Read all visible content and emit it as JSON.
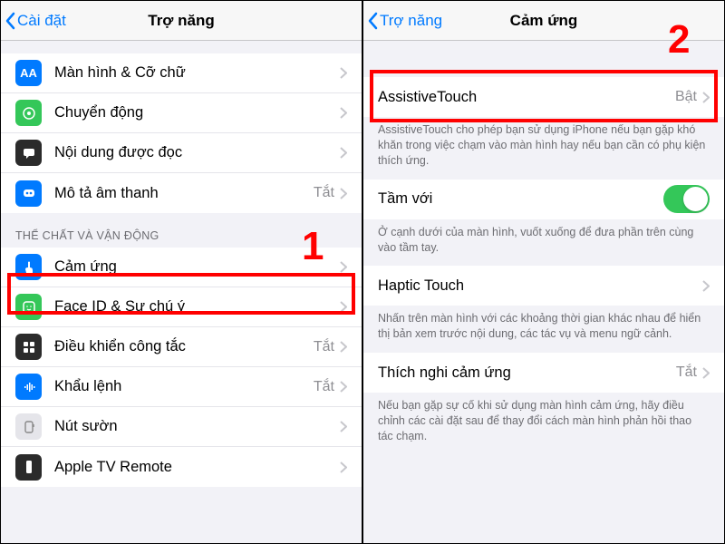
{
  "left": {
    "back": "Cài đặt",
    "title": "Trợ năng",
    "rows1": [
      {
        "icon": "AA",
        "color": "#007aff",
        "label": "Màn hình & Cỡ chữ",
        "value": ""
      },
      {
        "icon": "motion",
        "color": "#34c759",
        "label": "Chuyển động",
        "value": ""
      },
      {
        "icon": "speak",
        "color": "#2b2b2b",
        "label": "Nội dung được đọc",
        "value": ""
      },
      {
        "icon": "audio",
        "color": "#007aff",
        "label": "Mô tả âm thanh",
        "value": "Tắt"
      }
    ],
    "section2": "THỂ CHẤT VÀ VẬN ĐỘNG",
    "rows2": [
      {
        "icon": "touch",
        "color": "#007aff",
        "label": "Cảm ứng",
        "value": ""
      },
      {
        "icon": "face",
        "color": "#34c759",
        "label": "Face ID & Sự chú ý",
        "value": ""
      },
      {
        "icon": "switch",
        "color": "#2b2b2b",
        "label": "Điều khiển công tắc",
        "value": "Tắt"
      },
      {
        "icon": "voice",
        "color": "#007aff",
        "label": "Khẩu lệnh",
        "value": "Tắt"
      },
      {
        "icon": "side",
        "color": "#d1d1d6",
        "label": "Nút sườn",
        "value": ""
      },
      {
        "icon": "tv",
        "color": "#2b2b2b",
        "label": "Apple TV Remote",
        "value": ""
      }
    ],
    "badge": "1"
  },
  "right": {
    "back": "Trợ năng",
    "title": "Cảm ứng",
    "row_assistive": {
      "label": "AssistiveTouch",
      "value": "Bật"
    },
    "footer_assistive": "AssistiveTouch cho phép bạn sử dụng iPhone nếu bạn gặp khó khăn trong việc chạm vào màn hình hay nếu bạn cần có phụ kiện thích ứng.",
    "row_reach": {
      "label": "Tầm với"
    },
    "footer_reach": "Ở cạnh dưới của màn hình, vuốt xuống để đưa phần trên cùng vào tầm tay.",
    "row_haptic": {
      "label": "Haptic Touch"
    },
    "footer_haptic": "Nhấn trên màn hình với các khoảng thời gian khác nhau để hiển thị bản xem trước nội dung, các tác vụ và menu ngữ cảnh.",
    "row_accom": {
      "label": "Thích nghi cảm ứng",
      "value": "Tắt"
    },
    "footer_accom": "Nếu bạn gặp sự cố khi sử dụng màn hình cảm ứng, hãy điều chỉnh các cài đặt sau để thay đổi cách màn hình phản hồi thao tác chạm.",
    "badge": "2"
  }
}
